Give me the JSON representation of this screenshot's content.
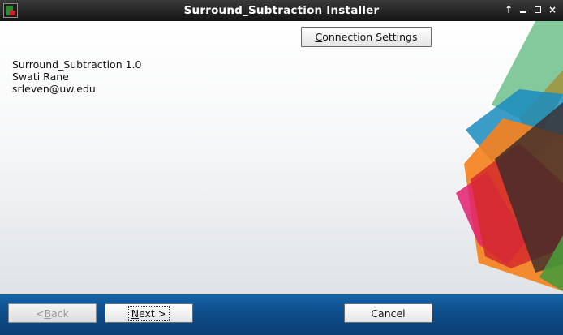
{
  "window": {
    "title": "Surround_Subtraction Installer",
    "controls": {
      "pin": "↑",
      "minimize": "minimize",
      "maximize": "maximize",
      "close": "×"
    }
  },
  "content": {
    "connection_button": {
      "mnemonic": "C",
      "rest": "onnection Settings"
    },
    "info_lines": [
      "Surround_Subtraction 1.0",
      "Swati Rane",
      "srleven@uw.edu"
    ]
  },
  "footer": {
    "back": {
      "prefix": "< ",
      "mnemonic": "B",
      "rest": "ack",
      "enabled": false
    },
    "next": {
      "mnemonic": "N",
      "rest": "ext >",
      "enabled": true
    },
    "cancel": {
      "label": "Cancel",
      "enabled": true
    }
  },
  "colors": {
    "titlebar": "#1f1f1f",
    "footer": "#0f4f8c",
    "deco_green": "#6fc08a",
    "deco_olive": "#8a8a2a",
    "deco_blue": "#1a8cc0",
    "deco_orange": "#f58220",
    "deco_red": "#d42a2a",
    "deco_magenta": "#e0206e",
    "deco_dark": "#3a2a2a"
  }
}
